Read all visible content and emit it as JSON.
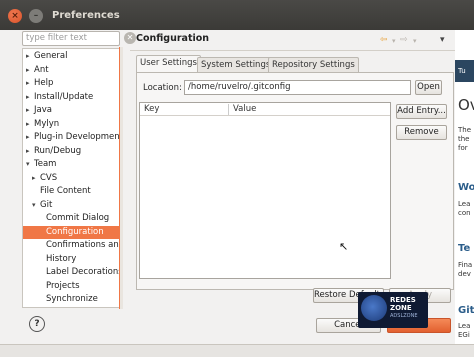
{
  "window": {
    "title": "Preferences"
  },
  "filter": {
    "placeholder": "type filter text"
  },
  "tree": {
    "items": [
      {
        "label": "General",
        "arrow": "▸",
        "level": 0
      },
      {
        "label": "Ant",
        "arrow": "▸",
        "level": 0
      },
      {
        "label": "Help",
        "arrow": "▸",
        "level": 0
      },
      {
        "label": "Install/Update",
        "arrow": "▸",
        "level": 0
      },
      {
        "label": "Java",
        "arrow": "▸",
        "level": 0
      },
      {
        "label": "Mylyn",
        "arrow": "▸",
        "level": 0
      },
      {
        "label": "Plug-in Development",
        "arrow": "▸",
        "level": 0
      },
      {
        "label": "Run/Debug",
        "arrow": "▸",
        "level": 0
      },
      {
        "label": "Team",
        "arrow": "▾",
        "level": 0
      },
      {
        "label": "CVS",
        "arrow": "▸",
        "level": 1
      },
      {
        "label": "File Content",
        "arrow": "",
        "level": 1
      },
      {
        "label": "Git",
        "arrow": "▾",
        "level": 1
      },
      {
        "label": "Commit Dialog",
        "arrow": "",
        "level": 2
      },
      {
        "label": "Configuration",
        "arrow": "",
        "level": 2,
        "selected": true
      },
      {
        "label": "Confirmations and",
        "arrow": "",
        "level": 2
      },
      {
        "label": "History",
        "arrow": "",
        "level": 2
      },
      {
        "label": "Label Decorations",
        "arrow": "",
        "level": 2
      },
      {
        "label": "Projects",
        "arrow": "",
        "level": 2
      },
      {
        "label": "Synchronize",
        "arrow": "",
        "level": 2
      }
    ]
  },
  "page": {
    "title": "Configuration",
    "nav_back": "⇦",
    "nav_back_menu": "▾",
    "nav_forward": "⇨",
    "nav_forward_menu": "▾",
    "view_menu": "▾"
  },
  "tabs": [
    {
      "label": "User Settings",
      "active": true
    },
    {
      "label": "System Settings"
    },
    {
      "label": "Repository Settings"
    }
  ],
  "location": {
    "label": "Location:",
    "value": "/home/ruvelro/.gitconfig",
    "open_label": "Open"
  },
  "table": {
    "columns": [
      "Key",
      "Value"
    ],
    "rows": []
  },
  "buttons": {
    "add_entry": "Add Entry...",
    "remove": "Remove",
    "restore_defaults": "Restore Defaults",
    "apply": "Apply",
    "cancel": "Cancel",
    "ok": "OK"
  },
  "watermark": {
    "line1": "REDES",
    "line2": "ZONE",
    "line3": "ADSLZONE"
  },
  "background_app": {
    "fragments": [
      "Tu",
      "Ov",
      "The",
      "the",
      "for",
      "Wo",
      "Lea",
      "con",
      "Te",
      "Fina",
      "dev",
      "Git",
      "Lea",
      "EGi"
    ]
  },
  "colors": {
    "accent": "#f07746",
    "titlebar": "#3c3b37"
  }
}
